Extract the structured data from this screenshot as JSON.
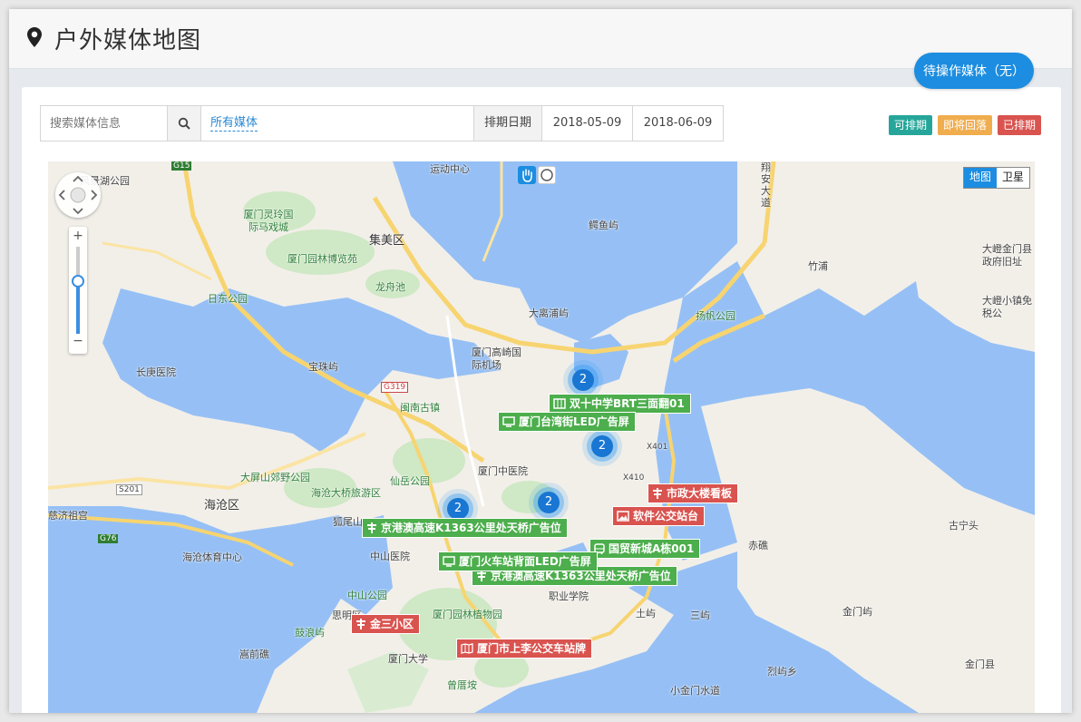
{
  "header": {
    "title": "户外媒体地图"
  },
  "pending_button": "待操作媒体（无）",
  "toolbar": {
    "search_placeholder": "搜索媒体信息",
    "media_filter": "所有媒体",
    "date_label": "排期日期",
    "date_start": "2018-05-09",
    "date_end": "2018-06-09"
  },
  "legend": [
    {
      "label": "可排期",
      "color": "#26a69a"
    },
    {
      "label": "即将回落",
      "color": "#f0ad4e"
    },
    {
      "label": "已排期",
      "color": "#d9534f"
    }
  ],
  "map": {
    "type_buttons": {
      "map": "地图",
      "satellite": "卫星"
    },
    "zoom": {
      "in": "+",
      "out": "−"
    },
    "places": [
      "风景湖公园",
      "厦门灵玲国际马戏城",
      "集美区",
      "厦门园林博览苑",
      "龙舟池",
      "日东公园",
      "长庚医院",
      "宝珠屿",
      "鳄鱼屿",
      "大离浦屿",
      "厦门高崎国际机场",
      "扬帆公园",
      "竹浦",
      "大嶝金门县政府旧址",
      "大嶝小镇免税公",
      "闽南古镇",
      "厦门中医院",
      "仙岳公园",
      "大屏山郊野公园",
      "海沧大桥旅游区",
      "海沧区",
      "慈济祖宫",
      "海沧体育中心",
      "中山医院",
      "中山公园",
      "思明区",
      "鼓浪屿",
      "嵩前礁",
      "厦门园林植物园",
      "厦门大学",
      "曾厝垵",
      "职业学院",
      "赤礁",
      "土屿",
      "三屿",
      "金门屿",
      "古宁头",
      "金门县",
      "烈屿乡",
      "小金门水道",
      "运动中心",
      "翔安大道",
      "狐尾山"
    ],
    "markers": [
      {
        "label": "双十中学BRT三面翻01",
        "status": "available",
        "icon": "billboard-icon"
      },
      {
        "label": "厦门台湾街LED广告屏",
        "status": "available",
        "icon": "screen-icon"
      },
      {
        "label": "市政大楼看板",
        "status": "booked",
        "icon": "signpost-icon"
      },
      {
        "label": "软件公交站台",
        "status": "booked",
        "icon": "image-icon"
      },
      {
        "label": "国贸新城A栋001",
        "status": "available",
        "icon": "bus-icon"
      },
      {
        "label": "京港澳高速K1363公里处天桥广告位",
        "status": "available",
        "icon": "signpost-icon"
      },
      {
        "label": "厦门火车站背面LED广告屏",
        "status": "available",
        "icon": "screen-icon"
      },
      {
        "label": "京港澳高速K1363公里处天桥广告位",
        "status": "available",
        "icon": "signpost-icon"
      },
      {
        "label": "金三小区",
        "status": "booked",
        "icon": "signpost-icon"
      },
      {
        "label": "厦门市上李公交车站牌",
        "status": "booked",
        "icon": "map-icon"
      }
    ],
    "clusters": [
      "2",
      "2",
      "2",
      "2"
    ],
    "road_labels": [
      "G319",
      "S201",
      "G76",
      "X401",
      "X410",
      "G15"
    ]
  }
}
